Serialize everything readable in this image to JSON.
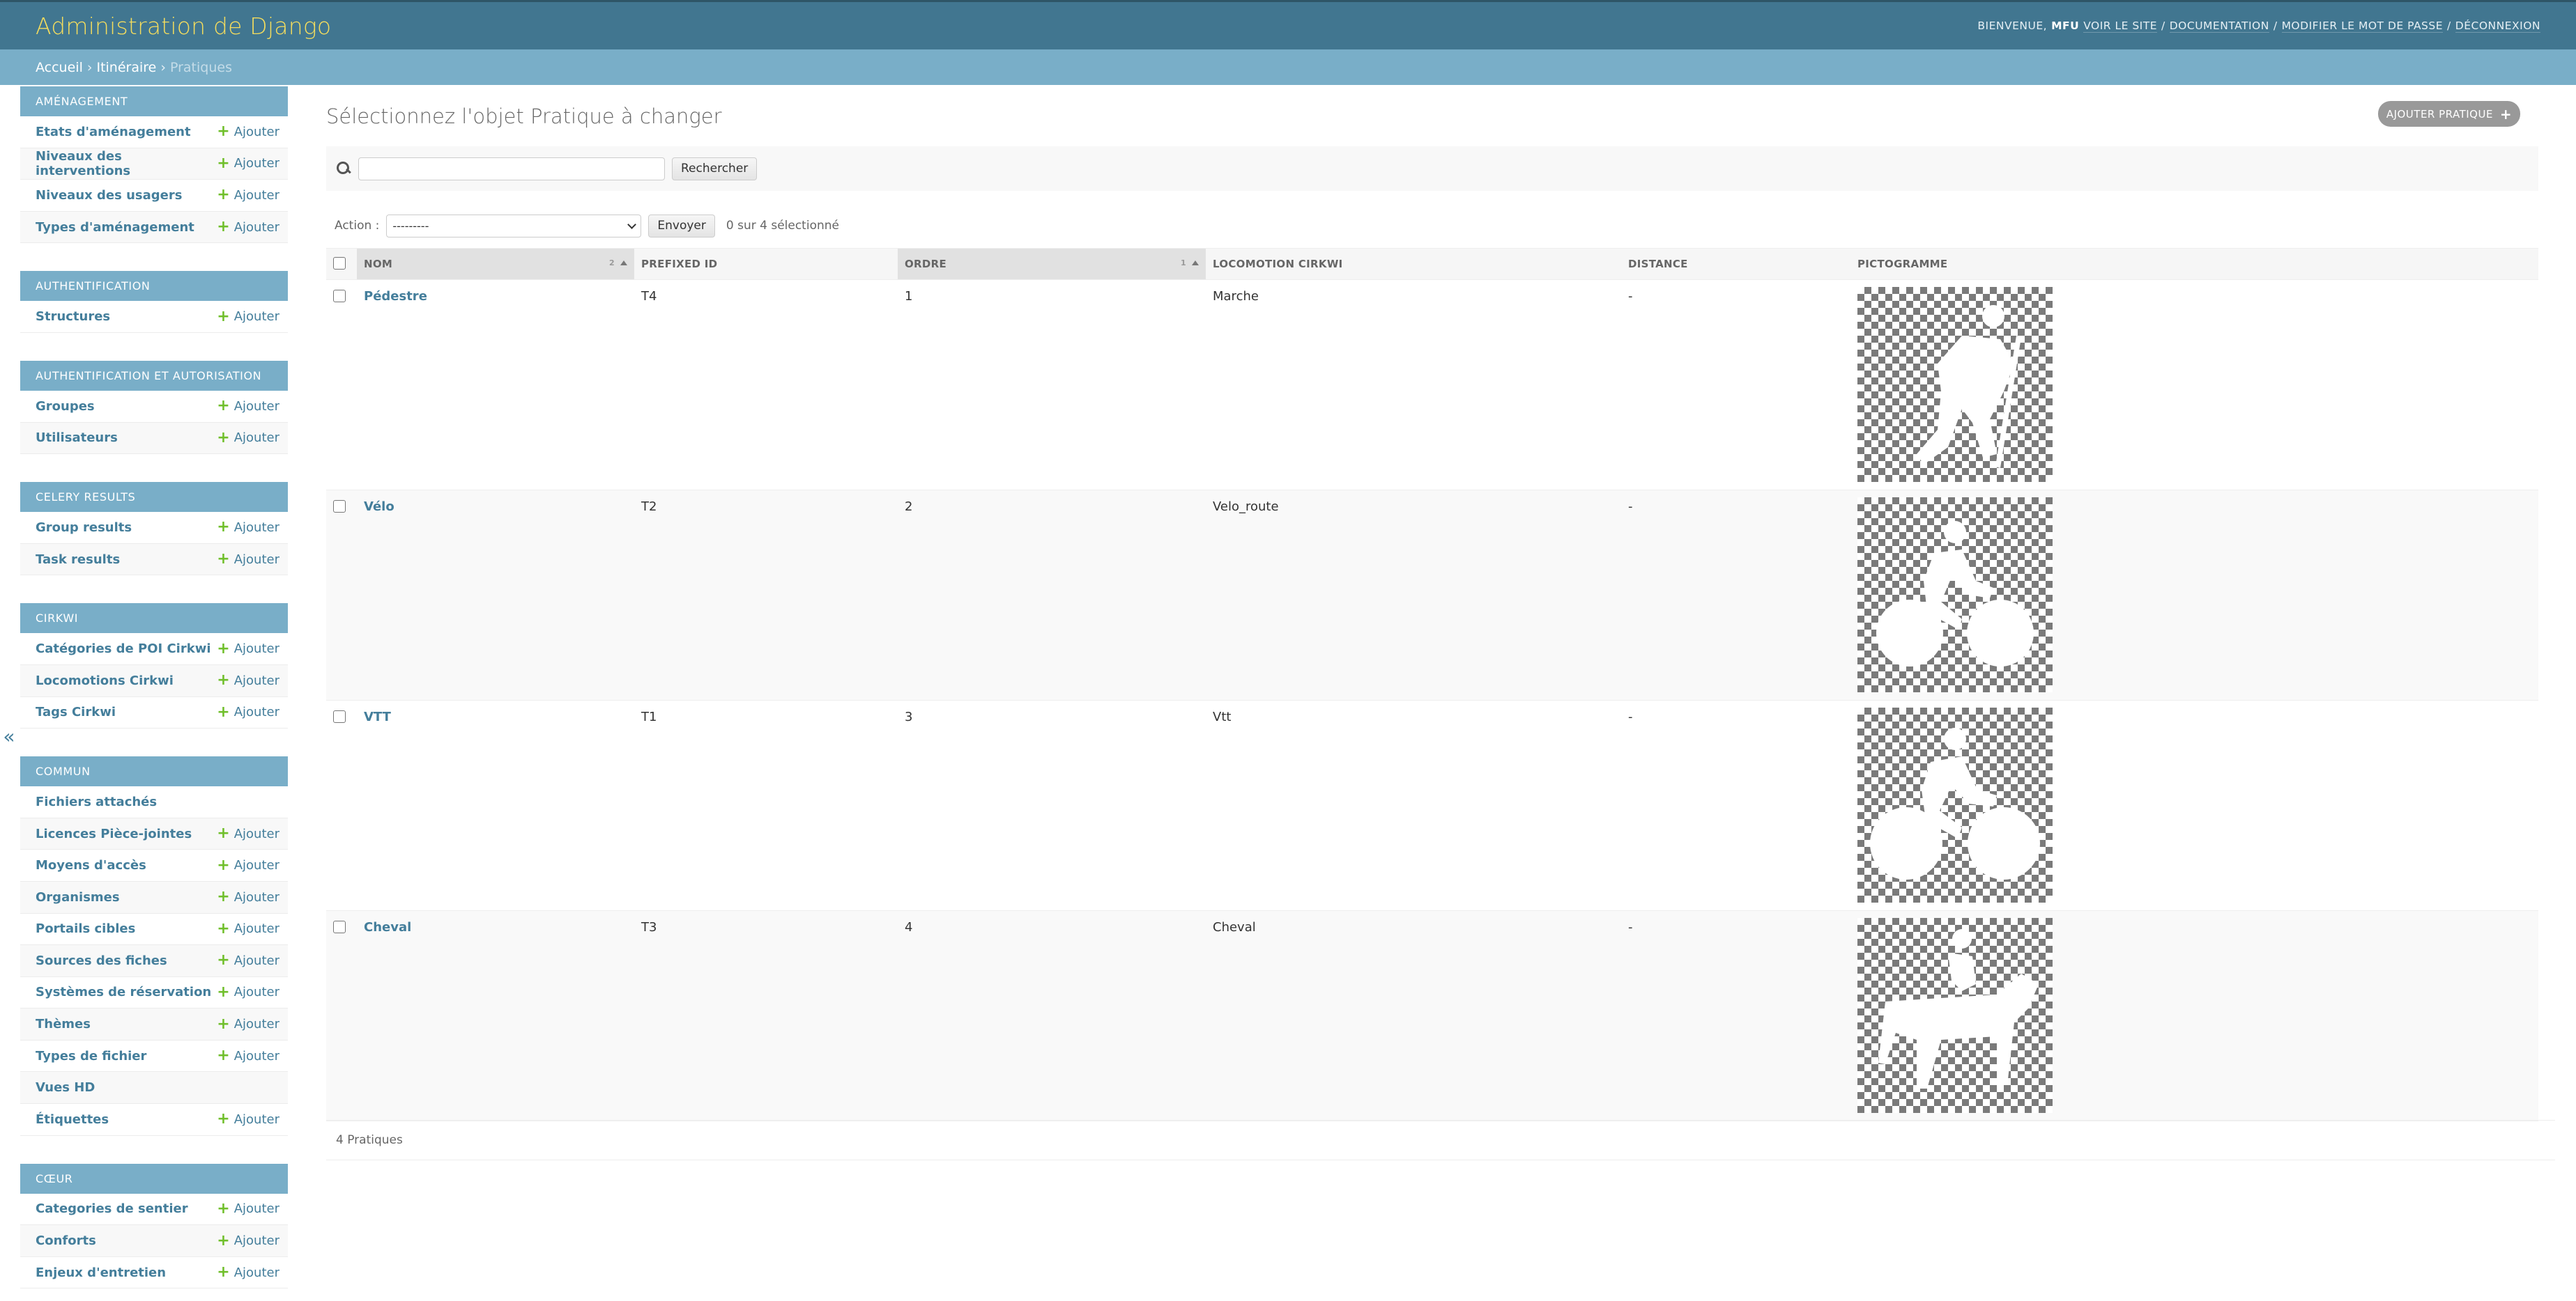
{
  "header": {
    "site_title": "Administration de Django",
    "welcome": "Bienvenue,",
    "username": "MFU",
    "links": [
      "Voir le site",
      "Documentation",
      "Modifier le mot de passe",
      "Déconnexion"
    ]
  },
  "breadcrumbs": {
    "home": "Accueil",
    "app": "Itinéraire",
    "current": "Pratiques",
    "separator": "›"
  },
  "sidebar": {
    "toggle": "«",
    "add_label": "Ajouter",
    "modules": [
      {
        "caption": "Aménagement",
        "models": [
          {
            "name": "Etats d'aménagement",
            "add": true
          },
          {
            "name": "Niveaux des interventions",
            "add": true
          },
          {
            "name": "Niveaux des usagers",
            "add": true
          },
          {
            "name": "Types d'aménagement",
            "add": true
          }
        ]
      },
      {
        "caption": "Authentification",
        "models": [
          {
            "name": "Structures",
            "add": true
          }
        ]
      },
      {
        "caption": "Authentification et autorisation",
        "models": [
          {
            "name": "Groupes",
            "add": true
          },
          {
            "name": "Utilisateurs",
            "add": true
          }
        ]
      },
      {
        "caption": "Celery Results",
        "models": [
          {
            "name": "Group results",
            "add": true
          },
          {
            "name": "Task results",
            "add": true
          }
        ]
      },
      {
        "caption": "Cirkwi",
        "models": [
          {
            "name": "Catégories de POI Cirkwi",
            "add": true
          },
          {
            "name": "Locomotions Cirkwi",
            "add": true
          },
          {
            "name": "Tags Cirkwi",
            "add": true
          }
        ]
      },
      {
        "caption": "Commun",
        "models": [
          {
            "name": "Fichiers attachés",
            "add": false
          },
          {
            "name": "Licences Pièce-jointes",
            "add": true
          },
          {
            "name": "Moyens d'accès",
            "add": true
          },
          {
            "name": "Organismes",
            "add": true
          },
          {
            "name": "Portails cibles",
            "add": true
          },
          {
            "name": "Sources des fiches",
            "add": true
          },
          {
            "name": "Systèmes de réservation",
            "add": true
          },
          {
            "name": "Thèmes",
            "add": true
          },
          {
            "name": "Types de fichier",
            "add": true
          },
          {
            "name": "Vues HD",
            "add": false
          },
          {
            "name": "Étiquettes",
            "add": true
          }
        ]
      },
      {
        "caption": "Cœur",
        "models": [
          {
            "name": "Categories de sentier",
            "add": true
          },
          {
            "name": "Conforts",
            "add": true
          },
          {
            "name": "Enjeux d'entretien",
            "add": true
          }
        ]
      }
    ]
  },
  "content": {
    "title": "Sélectionnez l'objet Pratique à changer",
    "add_button": "Ajouter Pratique",
    "search_button": "Rechercher",
    "search_value": "",
    "action_label": "Action :",
    "action_selected": "---------",
    "action_submit": "Envoyer",
    "action_counter": "0 sur 4 sélectionné",
    "columns": [
      "Nom",
      "Prefixed ID",
      "Ordre",
      "Locomotion cirkwi",
      "Distance",
      "Pictogramme"
    ],
    "sort_priority_nom": "2",
    "sort_priority_ordre": "1",
    "rows": [
      {
        "nom": "Pédestre",
        "prefixed_id": "T4",
        "ordre": "1",
        "locomotion": "Marche",
        "distance": "-",
        "picto": "hiker-icon"
      },
      {
        "nom": "Vélo",
        "prefixed_id": "T2",
        "ordre": "2",
        "locomotion": "Velo_route",
        "distance": "-",
        "picto": "cyclist-icon"
      },
      {
        "nom": "VTT",
        "prefixed_id": "T1",
        "ordre": "3",
        "locomotion": "Vtt",
        "distance": "-",
        "picto": "mountain-bike-icon"
      },
      {
        "nom": "Cheval",
        "prefixed_id": "T3",
        "ordre": "4",
        "locomotion": "Cheval",
        "distance": "-",
        "picto": "horse-rider-icon"
      }
    ],
    "paginator": "4 Pratiques"
  },
  "colors": {
    "header_bg": "#417690",
    "site_title": "#f5dd5d",
    "breadcrumbs_bg": "#79aec8",
    "link": "#447e9b",
    "add_icon": "#70bf2b"
  }
}
